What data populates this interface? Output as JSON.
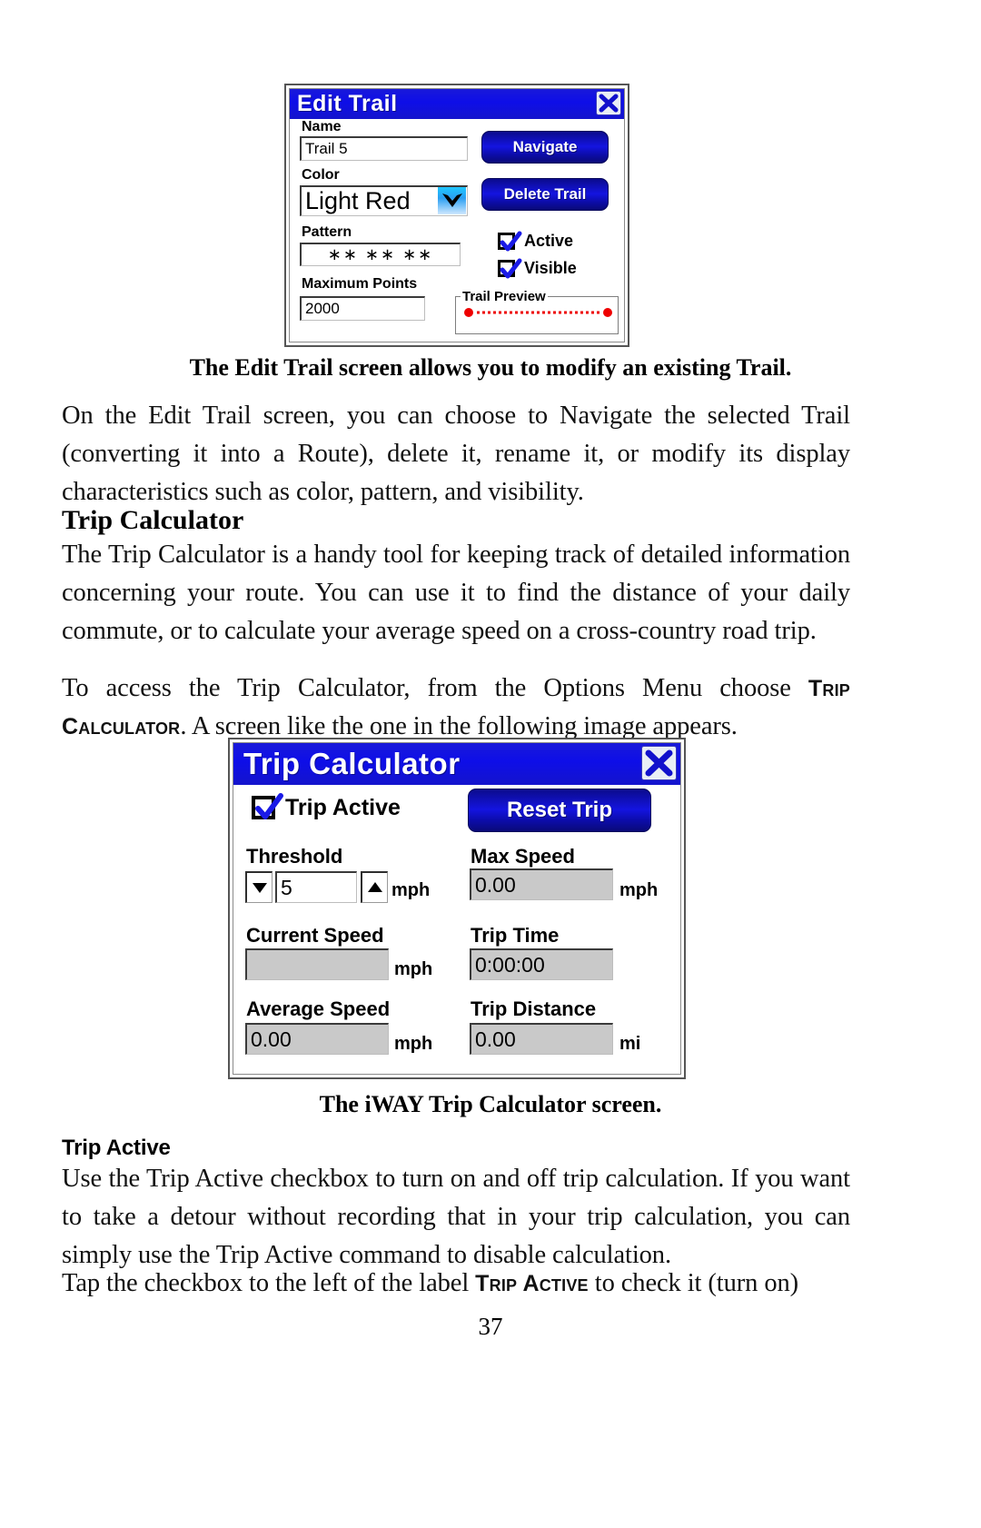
{
  "page": {
    "number": "37"
  },
  "figure1": {
    "title": "Edit Trail",
    "close_icon": "close-x-icon",
    "fields": {
      "name_label": "Name",
      "name_value": "Trail 5",
      "color_label": "Color",
      "color_value": "Light Red",
      "color_dropdown_icon": "chevron-down-icon",
      "pattern_label": "Pattern",
      "pattern_value": "∗∗  ∗∗  ∗∗",
      "max_points_label": "Maximum Points",
      "max_points_value": "2000"
    },
    "buttons": {
      "navigate": "Navigate",
      "delete_trail": "Delete Trail"
    },
    "checkboxes": [
      {
        "label": "Active",
        "checked": true
      },
      {
        "label": "Visible",
        "checked": true
      }
    ],
    "preview": {
      "group_label": "Trail Preview",
      "trail_color": "#ee0000"
    },
    "caption": "The Edit Trail screen allows you to modify an existing Trail."
  },
  "figure2": {
    "title": "Trip Calculator",
    "close_icon": "close-x-icon",
    "trip_active": {
      "label": "Trip Active",
      "checked": true
    },
    "reset_button": "Reset Trip",
    "fields": [
      {
        "label": "Threshold",
        "value": "5",
        "unit": "mph",
        "readonly": false,
        "spinner": true
      },
      {
        "label": "Max Speed",
        "value": "0.00",
        "unit": "mph",
        "readonly": true,
        "spinner": false
      },
      {
        "label": "Current Speed",
        "value": "",
        "unit": "mph",
        "readonly": true,
        "spinner": false
      },
      {
        "label": "Trip Time",
        "value": "0:00:00",
        "unit": "",
        "readonly": true,
        "spinner": false
      },
      {
        "label": "Average Speed",
        "value": "0.00",
        "unit": "mph",
        "readonly": true,
        "spinner": false
      },
      {
        "label": "Trip Distance",
        "value": "0.00",
        "unit": "mi",
        "readonly": true,
        "spinner": false
      }
    ],
    "spinner_down_icon": "triangle-down-icon",
    "spinner_up_icon": "triangle-up-icon",
    "caption": "The iWAY Trip Calculator screen."
  },
  "text": {
    "para1": "On the Edit Trail screen, you can choose to Navigate the selected Trail (converting it into a Route), delete it, rename it, or modify its display characteristics such as color, pattern, and visibility.",
    "heading_trip_calculator": "Trip Calculator",
    "para2": "The Trip Calculator is a handy tool for keeping track of detailed information concerning your route. You can use it to find the distance of your daily commute, or to calculate your average speed on a cross-country road trip.",
    "para3_a": "To access the Trip Calculator, from the Options Menu choose ",
    "para3_sc1": "Trip Calculator",
    "para3_b": ". A screen like the one in the following image appears.",
    "heading_trip_active": "Trip Active",
    "para4": "Use the Trip Active checkbox to turn on and off trip calculation. If you want to take a detour without recording that in your trip calculation, you can simply use the Trip Active command to disable calculation.",
    "para5_a": "Tap the checkbox to the left of the label ",
    "para5_sc": "Trip Active",
    "para5_b": " to check it (turn on)"
  }
}
